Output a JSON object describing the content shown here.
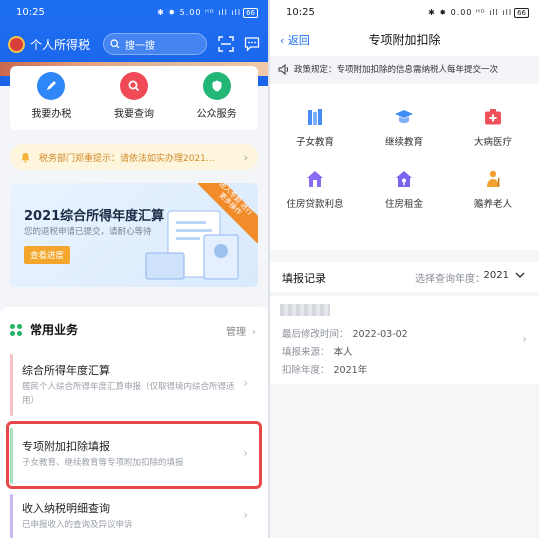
{
  "left": {
    "status_time": "10:25",
    "status_icons": "✱ ✸ 5.00 ᴴᴰ ıll ıll",
    "battery": "66",
    "app_title": "个人所得税",
    "search_placeholder": "搜一搜",
    "quick_actions": [
      {
        "label": "我要办税",
        "icon": "pen-icon",
        "color": "#2f86f6"
      },
      {
        "label": "我要查询",
        "icon": "search-icon",
        "color": "#f04a56"
      },
      {
        "label": "公众服务",
        "icon": "shield-icon",
        "color": "#22b776"
      }
    ],
    "notice": "税务部门郑重提示：请依法如实办理2021...",
    "promo": {
      "title": "2021综合所得年度汇算",
      "subtitle": "您的退税申请已提交，请耐心等待",
      "button": "查看进度",
      "ribbon": "进入专题 进行更多操作"
    },
    "section_title": "常用业务",
    "manage_label": "管理",
    "items": [
      {
        "title": "综合所得年度汇算",
        "desc": "居民个人综合所得年度汇算申报（仅取得境内综合所得适用）",
        "bar": "#f7c0c4"
      },
      {
        "title": "专项附加扣除填报",
        "desc": "子女教育、继续教育等专项附加扣除的填报",
        "bar": "#a8e0bb"
      },
      {
        "title": "收入纳税明细查询",
        "desc": "已申报收入的查询及异议申诉",
        "bar": "#c7b7f0"
      }
    ],
    "colors": {
      "header": "#1f6ff3",
      "highlight": "#e8484a"
    }
  },
  "right": {
    "status_time": "10:25",
    "status_icons": "✱ ✸ 0.00 ᴴᴰ ıll ıll",
    "battery": "66",
    "back_label": "返回",
    "title": "专项附加扣除",
    "policy": "政策规定：专项附加扣除的信息需纳税人每年提交一次",
    "categories": [
      {
        "label": "子女教育",
        "icon": "books-icon",
        "color": "#4a8cf5"
      },
      {
        "label": "继续教育",
        "icon": "graduation-cap-icon",
        "color": "#3e8ef4"
      },
      {
        "label": "大病医疗",
        "icon": "medical-kit-icon",
        "color": "#f0505a"
      },
      {
        "label": "住房贷款利息",
        "icon": "house-icon",
        "color": "#8a6cf2"
      },
      {
        "label": "住房租金",
        "icon": "house-key-icon",
        "color": "#7b63ec"
      },
      {
        "label": "赡养老人",
        "icon": "elder-icon",
        "color": "#f2a130"
      }
    ],
    "record_title": "填报记录",
    "year_label": "选择查询年度：",
    "year_value": "2021",
    "record": {
      "modified_label": "最后修改时间：",
      "modified_value": "2022-03-02",
      "source_label": "填报来源：",
      "source_value": "本人",
      "year_label": "扣除年度：",
      "year_value": "2021年"
    }
  }
}
